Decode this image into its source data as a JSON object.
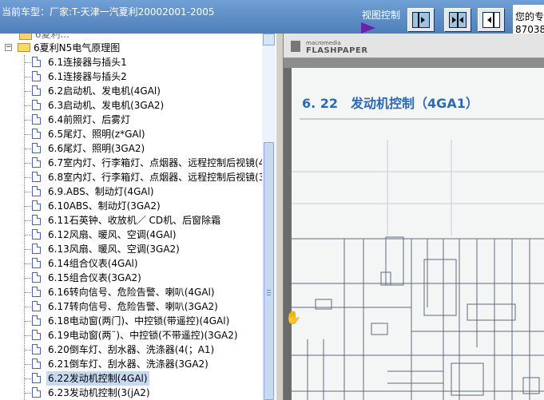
{
  "header": {
    "car_label": "当前车型：厂家:T-天津一汽夏利20002001-2005",
    "view_control": "视图控制",
    "welcome_line1": "您的专",
    "welcome_line2": "87038"
  },
  "tree": {
    "parent_partial": "6夏利...",
    "folder_label": "6夏利N5电气原理图",
    "items": [
      "6.1连接器与插头1",
      "6.1连接器与插头2",
      "6.2启动机、发电机(4GAl)",
      "6.3启动机、发电机(3GA2)",
      "6.4前照灯、后雾灯",
      "6.5尾灯、照明(z*GAl)",
      "6.6尾灯、照明(3GA2)",
      "6.7室内灯、行李箱灯、点烟器、远程控制后视镜(4",
      "6.8室内灯、行李箱灯、点烟器、远程控制后视镜(3",
      "6.9.ABS、制动灯(4GAl)",
      "6.10ABS、制动灯(3GA2)",
      "6.11石英钟、收放机／ CD机、后窗除霜",
      "6.12风扇、暖风、空调(4GAl)",
      "6.13风扇、暖风、空调(3GA2)",
      "6.14组合仪表(4GAl)",
      "6.15组合仪表(3GA2)",
      "6.16转向信号、危险告警、喇叭(4GAl)",
      "6.17转向信号、危险告警、喇叭(3GA2)",
      "6.18电动窗(两门)、中控锁(带遥控)(4GAl)",
      "6.19电动窗(两¨)、中控锁(不带遥控)(3GA2)",
      "6.20倒车灯、刮水器、洗涤器(4(；A1)",
      "6.21倒车灯、刮水器、洗涤器(3GA2)",
      "6.22发动机控制(4GAl)",
      "6.23发动机控制(3(jA2)"
    ],
    "selected_index": 22
  },
  "viewer": {
    "logo_small": "macromedia",
    "logo": "FLASHPAPER",
    "page_title": "6. 22　发动机控制（4GA1）"
  },
  "colors": {
    "header_bg": "#5a8cc8",
    "title_blue": "#2a6ab8",
    "selection": "#c6d9f1"
  }
}
